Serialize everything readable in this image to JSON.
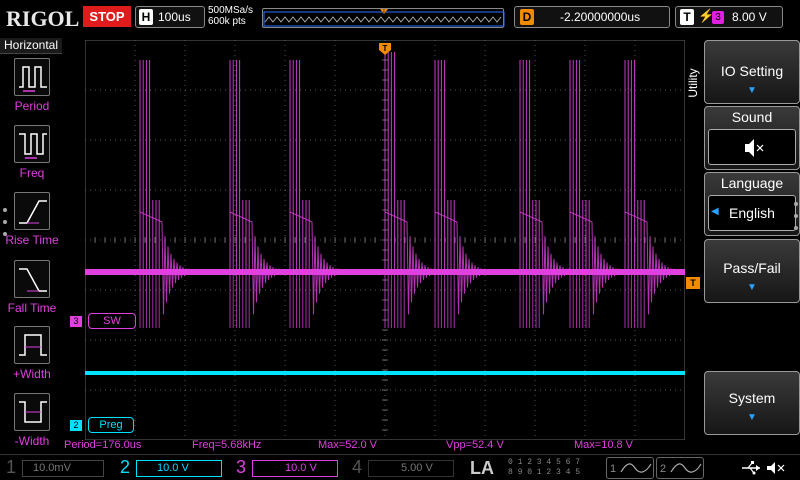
{
  "brand": "RIGOL",
  "run_status": "STOP",
  "horizontal": {
    "tag": "H",
    "timebase": "100us"
  },
  "acquisition": {
    "sample_rate": "500MSa/s",
    "memory_depth": "600k pts"
  },
  "delay": {
    "tag": "D",
    "value": "-2.20000000us"
  },
  "trigger": {
    "tag": "T",
    "source_channel": "3",
    "level": "8.00 V",
    "marker": "T"
  },
  "left_panel": {
    "title": "Horizontal",
    "items": [
      {
        "label": "Period",
        "icon": "period-icon"
      },
      {
        "label": "Freq",
        "icon": "freq-icon"
      },
      {
        "label": "Rise Time",
        "icon": "rise-time-icon"
      },
      {
        "label": "Fall Time",
        "icon": "fall-time-icon"
      },
      {
        "label": "+Width",
        "icon": "positive-width-icon"
      },
      {
        "label": "-Width",
        "icon": "negative-width-icon"
      }
    ]
  },
  "traces": {
    "ch3": {
      "marker": "3",
      "label": "SW",
      "color": "#e040e0"
    },
    "ch2": {
      "marker": "2",
      "label": "Preg",
      "color": "#00e0ff"
    }
  },
  "measurements": [
    {
      "text": "Period=176.0us"
    },
    {
      "text": "Freq=5.68kHz"
    },
    {
      "text": "Max=52.0 V"
    },
    {
      "text": "Vpp=52.4 V"
    },
    {
      "text": "Max=10.8 V"
    }
  ],
  "right_panel": {
    "tab": "Utility",
    "io_setting": "IO Setting",
    "sound_title": "Sound",
    "language_title": "Language",
    "language_value": "English",
    "pass_fail": "Pass/Fail",
    "system": "System"
  },
  "bottom_bar": {
    "ch1": {
      "num": "1",
      "scale": "10.0mV",
      "color": "#d8d800"
    },
    "ch2": {
      "num": "2",
      "scale": "10.0 V",
      "color": "#00e0ff"
    },
    "ch3": {
      "num": "3",
      "scale": "10.0 V",
      "color": "#e040e0"
    },
    "ch4": {
      "num": "4",
      "scale": "5.00 V",
      "color": "#4060ff"
    },
    "la": "LA",
    "la_digits_top": "0 1 2 3  4 5 6 7",
    "la_digits_bottom": "8 9 0 1  2 3 4 5",
    "math1": "1",
    "math2": "2"
  },
  "colors": {
    "ch3": "#e040e0",
    "ch2": "#00e0ff",
    "trigger": "#f28b00",
    "stop": "#e01b1b",
    "grid": "#555555"
  }
}
